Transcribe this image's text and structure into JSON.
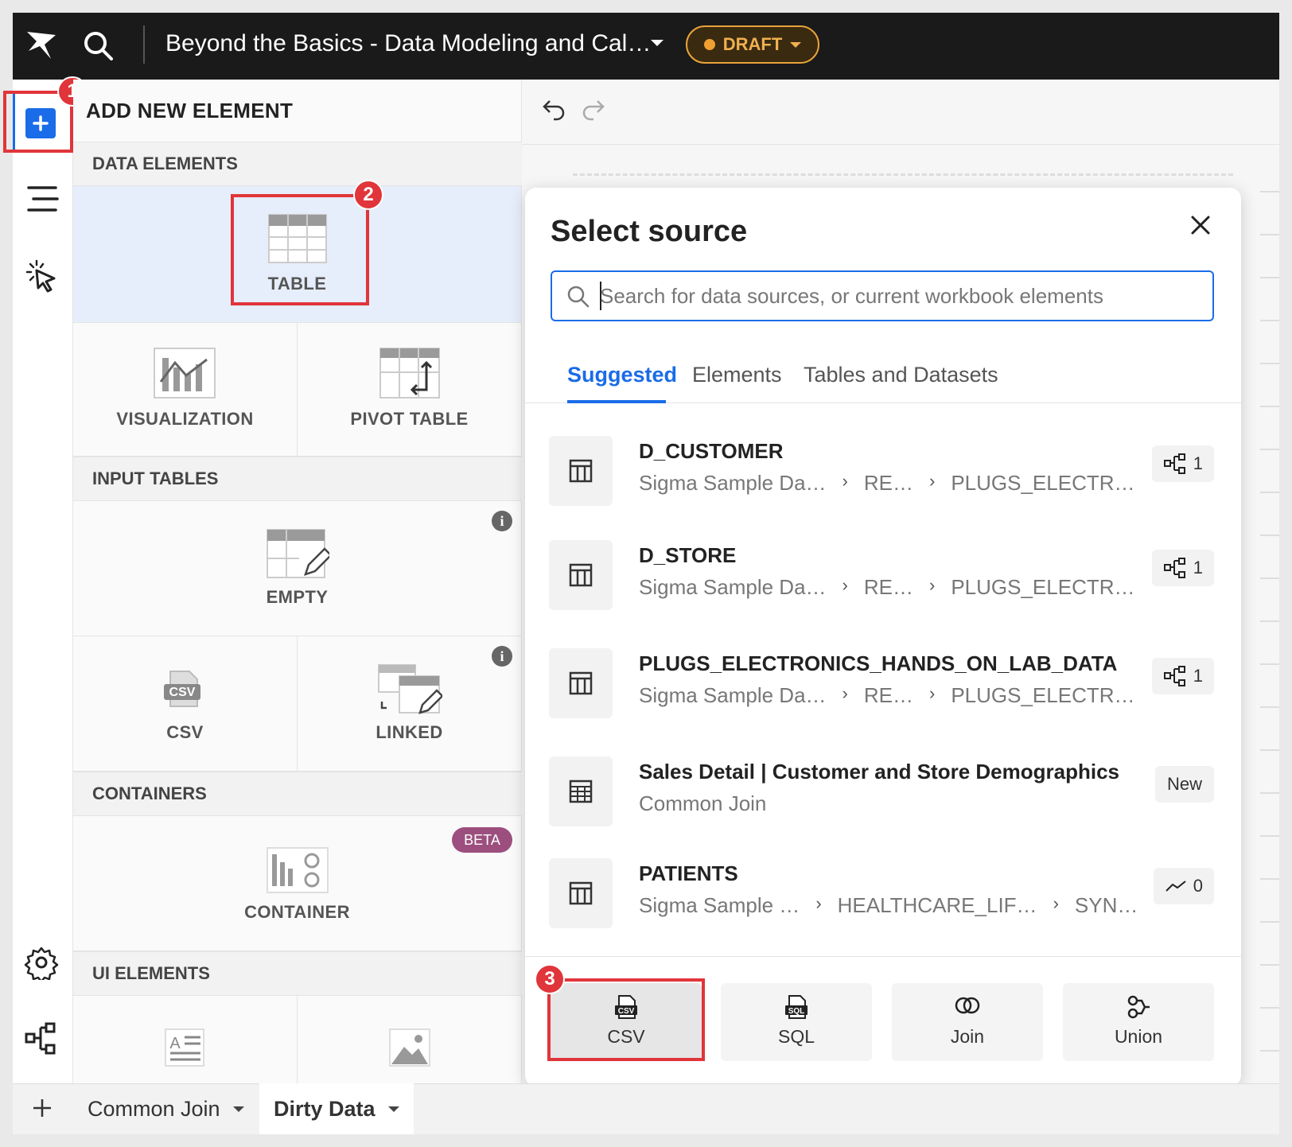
{
  "app": {
    "workbook_title": "Beyond the Basics - Data Modeling and Cal…",
    "status": "DRAFT"
  },
  "panel": {
    "title": "ADD NEW ELEMENT",
    "sections": {
      "data_elements": "DATA ELEMENTS",
      "input_tables": "INPUT TABLES",
      "containers": "CONTAINERS",
      "ui_elements": "UI ELEMENTS"
    },
    "tiles": {
      "table": "TABLE",
      "visualization": "VISUALIZATION",
      "pivot_table": "PIVOT TABLE",
      "empty": "EMPTY",
      "csv": "CSV",
      "linked": "LINKED",
      "container": "CONTAINER",
      "beta": "BETA"
    }
  },
  "modal": {
    "title": "Select source",
    "search_placeholder": "Search for data sources, or current workbook elements",
    "tabs": [
      "Suggested",
      "Elements",
      "Tables and Datasets"
    ],
    "rows": [
      {
        "name": "D_CUSTOMER",
        "path": [
          "Sigma Sample Da…",
          "RE…",
          "PLUGS_ELECTR…"
        ],
        "tag": "1",
        "tag_icon": "lineage-icon"
      },
      {
        "name": "D_STORE",
        "path": [
          "Sigma Sample Da…",
          "RE…",
          "PLUGS_ELECTR…"
        ],
        "tag": "1",
        "tag_icon": "lineage-icon"
      },
      {
        "name": "PLUGS_ELECTRONICS_HANDS_ON_LAB_DATA",
        "path": [
          "Sigma Sample Da…",
          "RE…",
          "PLUGS_ELECTR…"
        ],
        "tag": "1",
        "tag_icon": "lineage-icon"
      },
      {
        "name": "Sales Detail | Customer and Store Demographics",
        "path": [
          "Common Join"
        ],
        "tag": "New",
        "tag_icon": ""
      },
      {
        "name": "PATIENTS",
        "path": [
          "Sigma Sample …",
          "HEALTHCARE_LIF…",
          "SYN…"
        ],
        "tag": "0",
        "tag_icon": "trend-icon"
      }
    ],
    "footer": {
      "csv": "CSV",
      "sql": "SQL",
      "join": "Join",
      "union": "Union"
    }
  },
  "callouts": [
    "1",
    "2",
    "3"
  ],
  "bottom_tabs": [
    "Common Join",
    "Dirty Data"
  ],
  "colors": {
    "accent": "#1a6ce8",
    "highlight": "#e0353a",
    "draft": "#e8a33a",
    "beta": "#9c4f7e"
  }
}
